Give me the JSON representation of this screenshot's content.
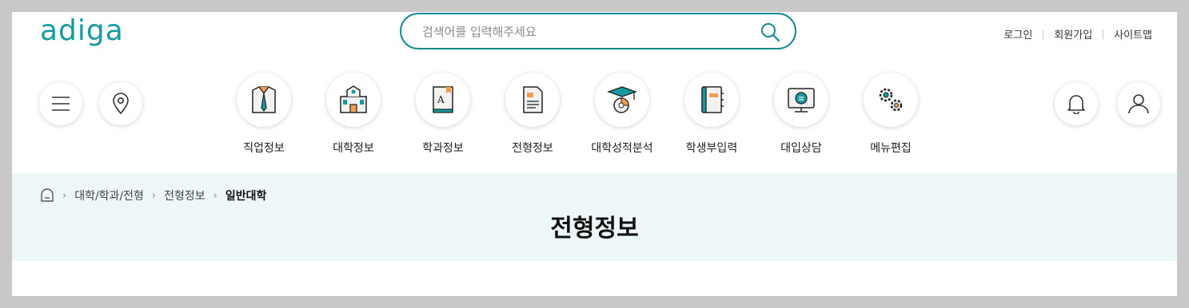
{
  "header": {
    "logo": "adiga",
    "search_placeholder": "검색어를 입력해주세요",
    "links": [
      "로그인",
      "회원가입",
      "사이트맵"
    ]
  },
  "menu": [
    {
      "label": "직업정보",
      "icon": "shirt-tie-icon"
    },
    {
      "label": "대학정보",
      "icon": "university-building-icon"
    },
    {
      "label": "학과정보",
      "icon": "book-icon"
    },
    {
      "label": "전형정보",
      "icon": "document-icon"
    },
    {
      "label": "대학성적분석",
      "icon": "graduation-chart-icon"
    },
    {
      "label": "학생부입력",
      "icon": "notebook-icon"
    },
    {
      "label": "대입상담",
      "icon": "counseling-monitor-icon"
    },
    {
      "label": "메뉴편집",
      "icon": "gears-icon"
    }
  ],
  "breadcrumb": [
    "대학/학과/전형",
    "전형정보",
    "일반대학"
  ],
  "page_title": "전형정보",
  "colors": {
    "accent": "#179ba0",
    "banner_bg": "#edf7f7"
  }
}
